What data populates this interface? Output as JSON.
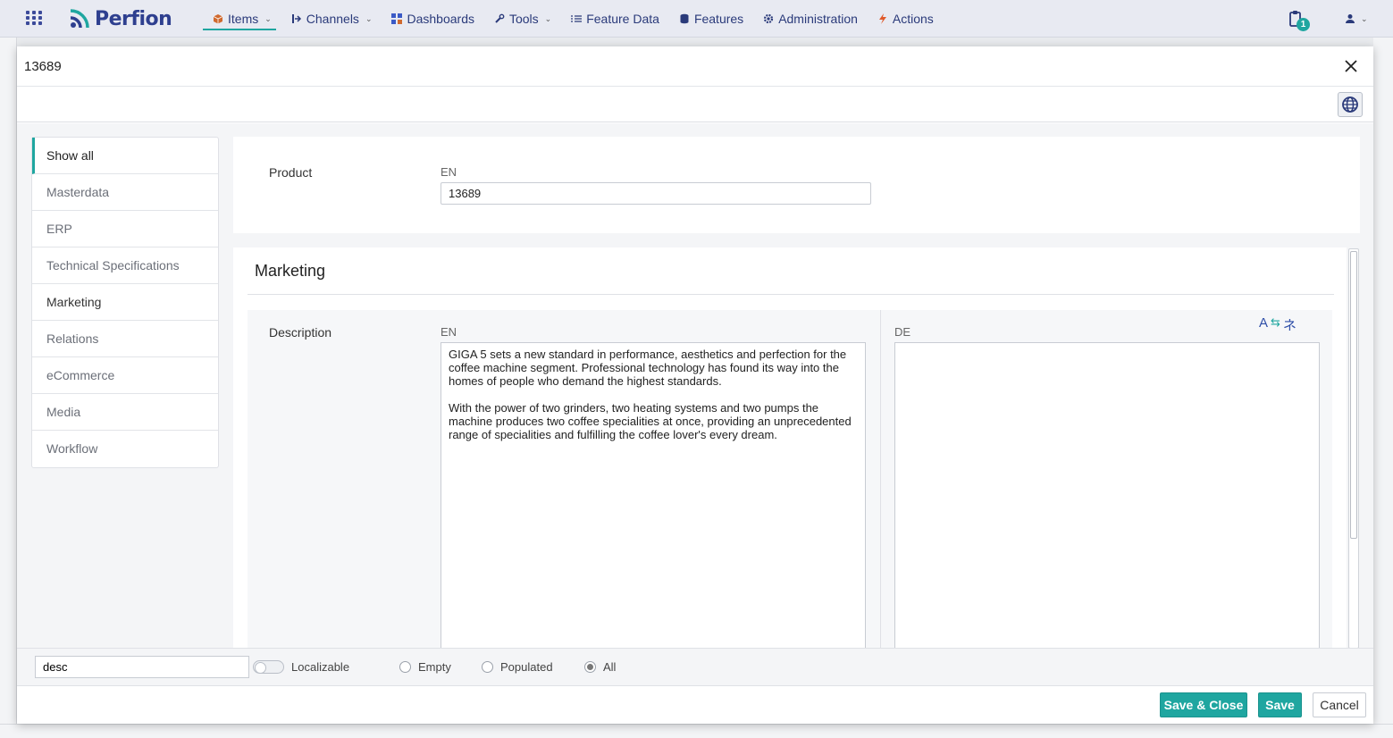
{
  "app": {
    "logo_text": "Perfion"
  },
  "nav": {
    "items": [
      {
        "label": "Items",
        "icon": "box-icon",
        "has_dropdown": true,
        "active": true
      },
      {
        "label": "Channels",
        "icon": "channel-icon",
        "has_dropdown": true
      },
      {
        "label": "Dashboards",
        "icon": "dashboard-icon",
        "has_dropdown": false
      },
      {
        "label": "Tools",
        "icon": "wrench-icon",
        "has_dropdown": true
      },
      {
        "label": "Feature Data",
        "icon": "list-icon",
        "has_dropdown": false
      },
      {
        "label": "Features",
        "icon": "database-icon",
        "has_dropdown": false
      },
      {
        "label": "Administration",
        "icon": "gear-icon",
        "has_dropdown": false
      },
      {
        "label": "Actions",
        "icon": "lightning-icon",
        "has_dropdown": false
      }
    ],
    "clipboard_badge": "1"
  },
  "modal": {
    "title": "13689",
    "sidenav": [
      {
        "label": "Show all",
        "active": true
      },
      {
        "label": "Masterdata"
      },
      {
        "label": "ERP"
      },
      {
        "label": "Technical Specifications"
      },
      {
        "label": "Marketing"
      },
      {
        "label": "Relations"
      },
      {
        "label": "eCommerce"
      },
      {
        "label": "Media"
      },
      {
        "label": "Workflow"
      }
    ],
    "product": {
      "label": "Product",
      "lang": "EN",
      "value": "13689"
    },
    "marketing": {
      "title": "Marketing",
      "description_label": "Description",
      "lang_en": "EN",
      "lang_de": "DE",
      "description_en": "GIGA 5 sets a new standard in performance, aesthetics and perfection for the coffee machine segment. Professional technology has found its way into the homes of people who demand the highest standards.\n\nWith the power of two grinders, two heating systems and two pumps the machine produces two coffee specialities at once, providing an unprecedented range of specialities and fulfilling the coffee lover's every dream.",
      "description_de": ""
    },
    "filters": {
      "search_value": "desc",
      "localizable_label": "Localizable",
      "radio_empty": "Empty",
      "radio_populated": "Populated",
      "radio_all": "All",
      "selected": "All"
    },
    "actions": {
      "save_close": "Save & Close",
      "save": "Save",
      "cancel": "Cancel"
    }
  },
  "colors": {
    "accent": "#1fa6a0",
    "brand": "#2e3f8f"
  }
}
